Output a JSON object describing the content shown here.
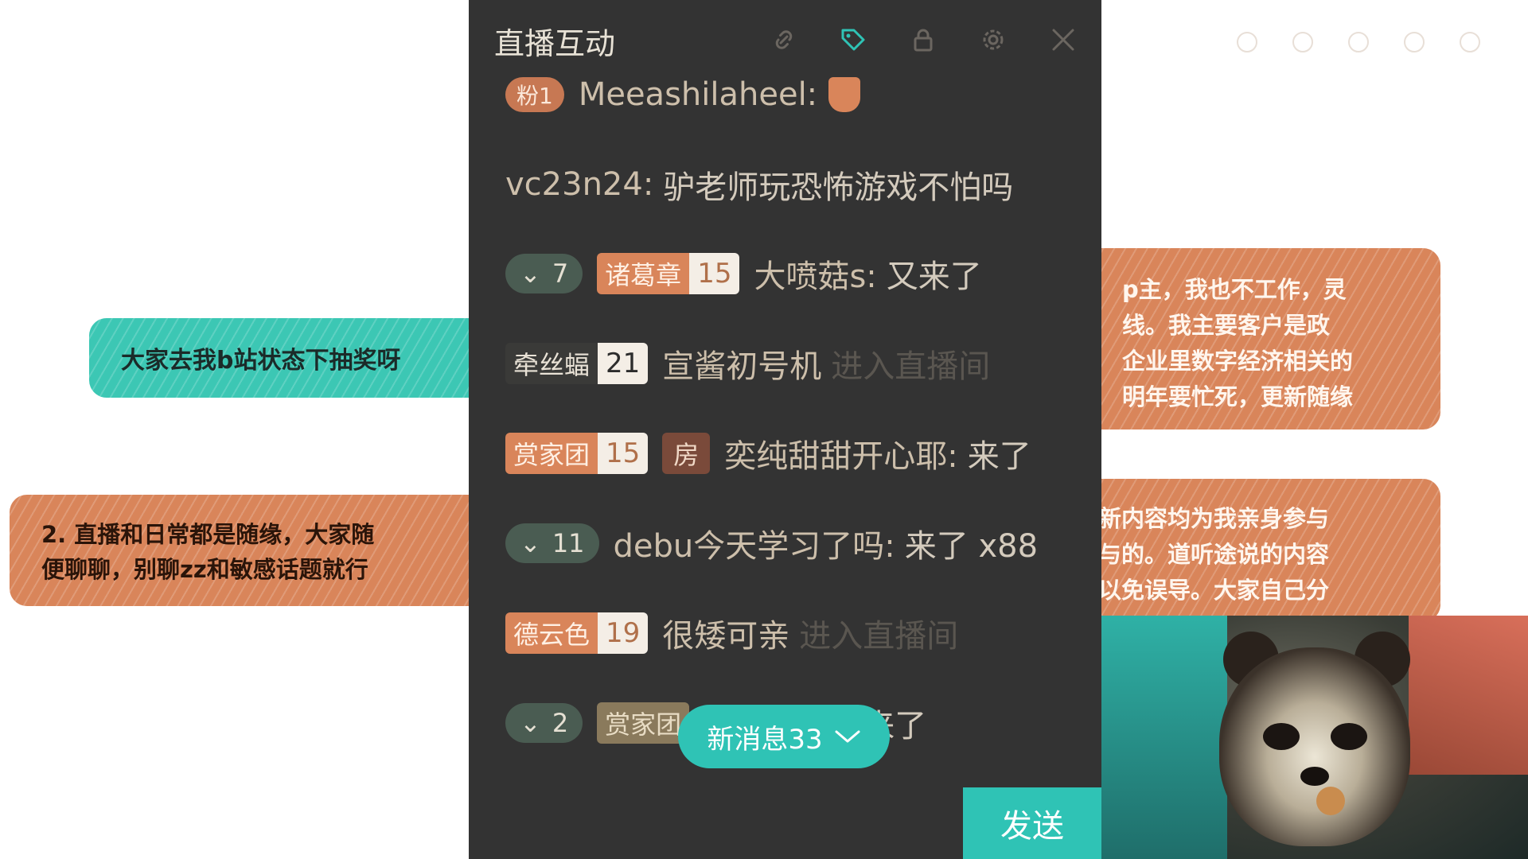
{
  "background": {
    "teal_note": "大家去我b站状态下抽奖呀",
    "orange_note_left": [
      "2. 直播和日常都是随缘，大家随",
      "便聊聊，别聊zz和敏感话题就行"
    ],
    "orange_note_right_top": [
      "p主，我也不工作，灵",
      "线。我主要客户是政",
      "企业里数字经济相关的",
      "明年要忙死，更新随缘"
    ],
    "orange_note_right_bottom": [
      "新内容均为我亲身参与",
      "与的。道听途说的内容",
      "以免误导。大家自己分"
    ]
  },
  "panel": {
    "title": "直播互动",
    "icons": [
      "link-icon",
      "tag-icon",
      "lock-icon",
      "gear-icon",
      "close-icon"
    ],
    "messages": [
      {
        "fan_badge": "粉1",
        "user": "Meeashilaheel:",
        "text": "",
        "gift_icon": "cup-icon"
      },
      {
        "user": "vc23n24:",
        "text": "驴老师玩恐怖游戏不怕吗"
      },
      {
        "guard_level": "7",
        "medal_name": "诸葛章",
        "medal_level": "15",
        "user": "大喷菇s:",
        "text": "又来了"
      },
      {
        "medal_name": "牵丝蝠",
        "medal_level": "21",
        "user": "宣酱初号机",
        "text": "进入直播间"
      },
      {
        "medal_name": "赏家团",
        "medal_level": "15",
        "room_badge": "房",
        "user": "奕纯甜甜开心耶:",
        "text": "来了"
      },
      {
        "guard_level": "11",
        "user": "debu今天学习了吗:",
        "text": "来了 x88"
      },
      {
        "medal_name": "德云色",
        "medal_level": "19",
        "user": "很矮可亲",
        "text": "进入直播间"
      },
      {
        "guard_level": "2",
        "medal_name": "赏家团",
        "user": "",
        "text": "来了"
      }
    ],
    "new_messages_button": "新消息33",
    "send_button": "发送"
  },
  "colors": {
    "panel_bg": "#333333",
    "accent_teal": "#2fc3b5",
    "medal_orange": "#d9855a"
  }
}
